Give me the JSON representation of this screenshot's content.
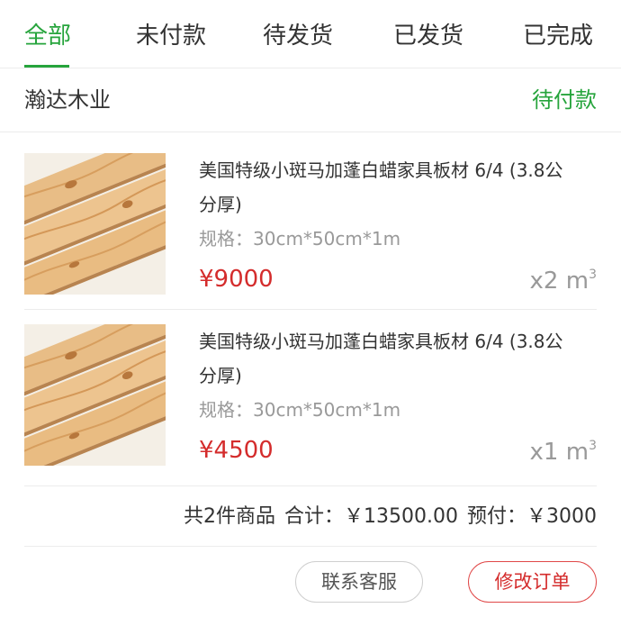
{
  "tabs": [
    {
      "label": "全部",
      "active": true
    },
    {
      "label": "未付款"
    },
    {
      "label": "待发货"
    },
    {
      "label": "已发货"
    },
    {
      "label": "已完成"
    }
  ],
  "shop": {
    "name": "瀚达木业",
    "status": "待付款"
  },
  "items": [
    {
      "title": "美国特级小斑马加蓬白蜡家具板材 6/4 (3.8公分厚)",
      "spec": "规格：30cm*50cm*1m",
      "price": "¥9000",
      "qty": "x2 m",
      "qty_unit_sup": "3"
    },
    {
      "title": "美国特级小斑马加蓬白蜡家具板材 6/4 (3.8公分厚)",
      "spec": "规格：30cm*50cm*1m",
      "price": "¥4500",
      "qty": "x1 m",
      "qty_unit_sup": "3"
    }
  ],
  "summary": {
    "count_text": "共2件商品",
    "total_text": "合计：￥13500.00",
    "prepay_text": "预付：￥3000"
  },
  "actions": {
    "contact": "联系客服",
    "edit": "修改订单"
  },
  "colors": {
    "accent": "#26a43c",
    "price": "#d42c2c",
    "muted": "#999999"
  }
}
